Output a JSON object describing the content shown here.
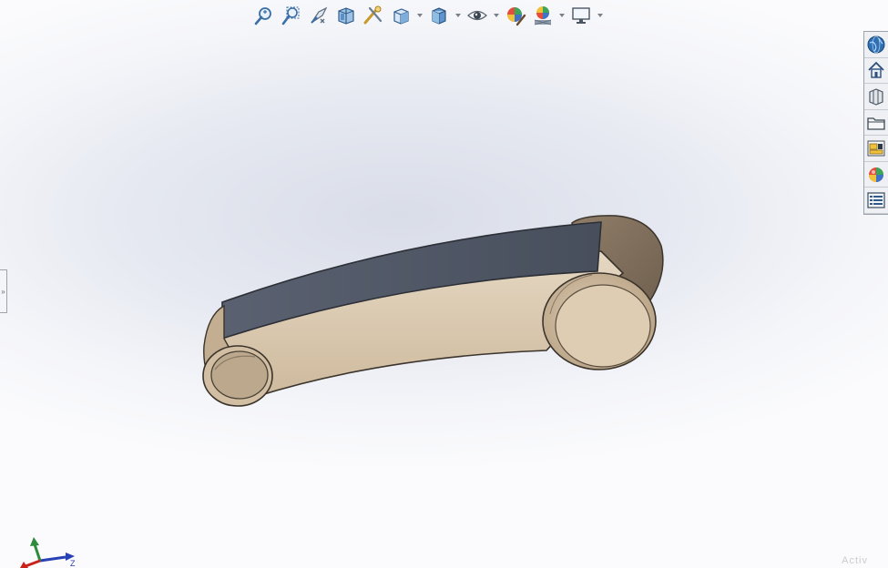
{
  "heads_up_toolbar": [
    {
      "id": "zoom-to-fit",
      "icon": "zoom-to-fit-icon"
    },
    {
      "id": "zoom-to-area",
      "icon": "zoom-to-area-icon"
    },
    {
      "id": "previous-view",
      "icon": "previous-view-icon"
    },
    {
      "id": "section-view",
      "icon": "section-view-icon"
    },
    {
      "id": "dynamic-annotation",
      "icon": "dynamic-annotation-icon"
    },
    {
      "id": "view-orientation",
      "icon": "view-orientation-icon",
      "dropdown": true
    },
    {
      "id": "display-style",
      "icon": "display-style-icon",
      "dropdown": true
    },
    {
      "id": "hide-show-items",
      "icon": "hide-show-items-icon",
      "dropdown": true
    },
    {
      "id": "edit-appearance",
      "icon": "edit-appearance-icon"
    },
    {
      "id": "apply-scene",
      "icon": "apply-scene-icon",
      "dropdown": true
    },
    {
      "id": "view-settings",
      "icon": "view-settings-icon",
      "dropdown": true
    }
  ],
  "task_pane": [
    {
      "id": "solidworks-resources",
      "icon": "globe-icon"
    },
    {
      "id": "design-library",
      "icon": "home-icon"
    },
    {
      "id": "file-explorer",
      "icon": "parts-icon"
    },
    {
      "id": "view-palette",
      "icon": "folder-icon"
    },
    {
      "id": "appearances",
      "icon": "scenes-icon"
    },
    {
      "id": "custom-properties",
      "icon": "color-ball-icon"
    },
    {
      "id": "forum",
      "icon": "list-icon"
    }
  ],
  "triad": {
    "axis_z_label": "Z"
  },
  "colors": {
    "part_body": "#d8c7ae",
    "part_top_face": "#4e5564",
    "background": "#e6e9f1"
  },
  "watermark": "Activ"
}
